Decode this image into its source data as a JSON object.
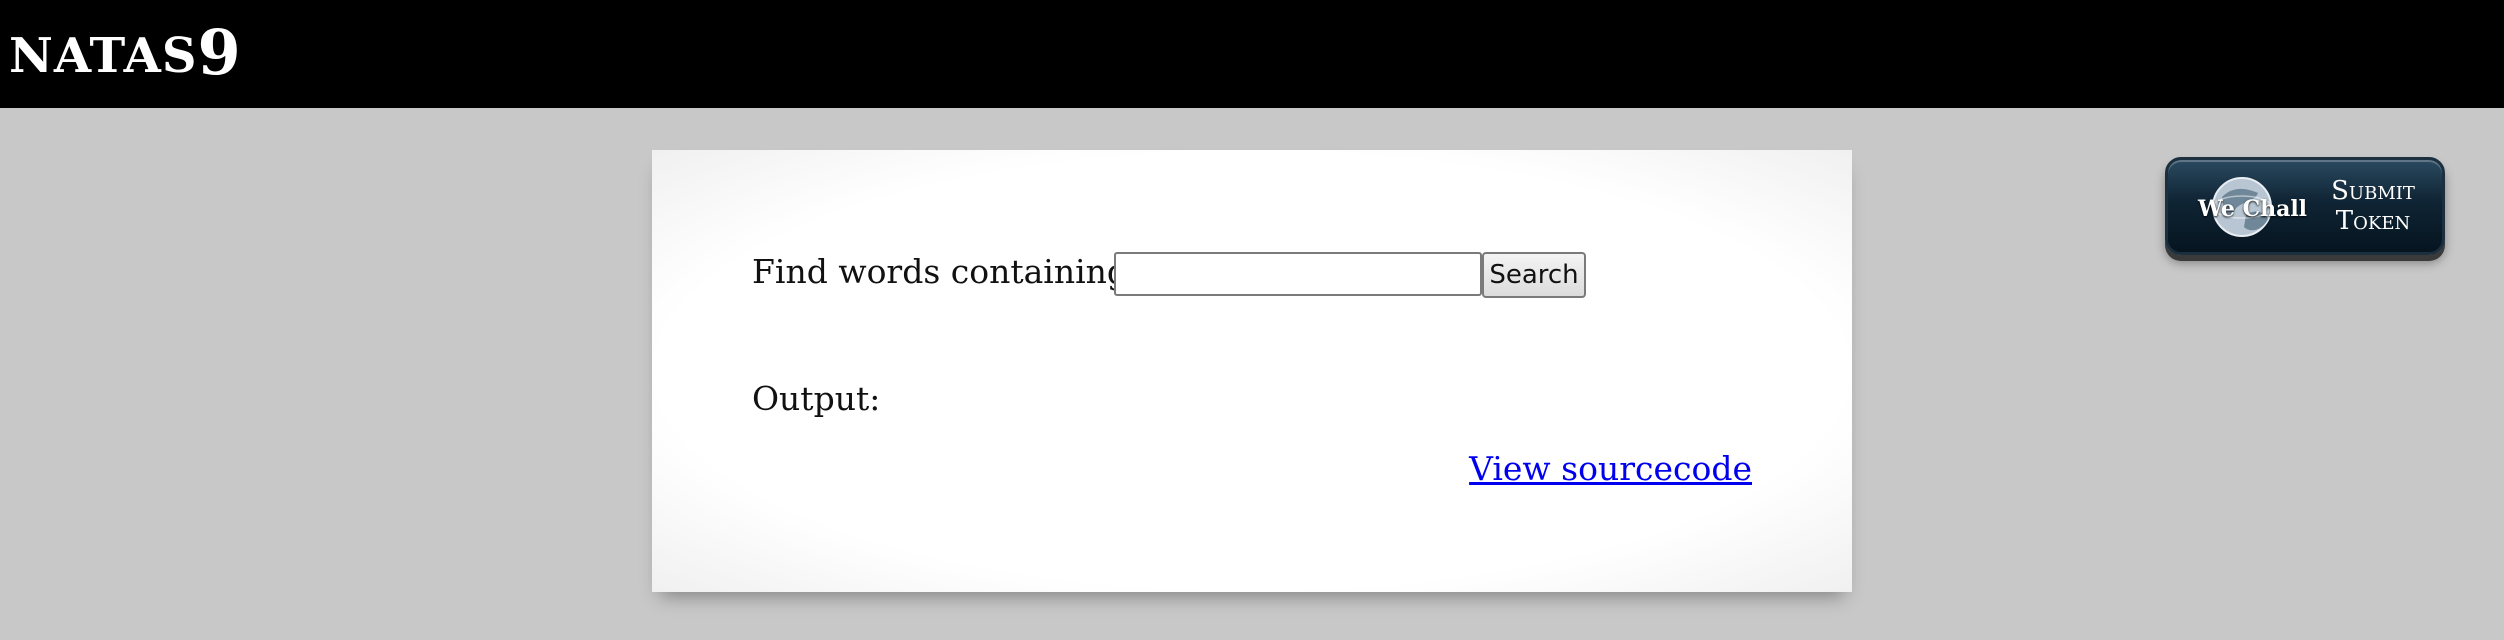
{
  "header": {
    "title": "NATAS",
    "title_number": "9"
  },
  "token_button": {
    "logo_text": "We Chall",
    "line1": "Submit",
    "line2": "Token"
  },
  "form": {
    "find_label": "Find words containing:",
    "needle_value": "",
    "search_label": "Search"
  },
  "output": {
    "label": "Output:"
  },
  "links": {
    "view_source": "View sourcecode"
  },
  "colors": {
    "page_bg": "#c8c8c8",
    "header_bg": "#000000",
    "link": "#0000ee"
  }
}
